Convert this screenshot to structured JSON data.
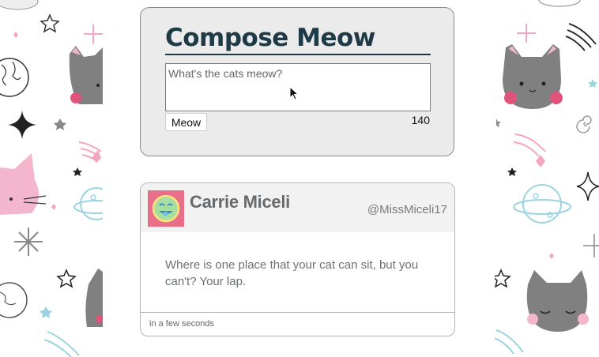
{
  "compose": {
    "title": "Compose Meow",
    "input_value": "",
    "placeholder": "What's the cats meow?",
    "button_label": "Meow",
    "char_count": "140"
  },
  "tweet": {
    "author_name": "Carrie Miceli",
    "handle": "@MissMiceli17",
    "text": "Where is one place that your cat can sit, but you can't? Your lap.",
    "timestamp": "in a few seconds"
  },
  "colors": {
    "title": "#1e3a47",
    "panel_bg": "#ebebeb",
    "avatar_bg": "#e76f8a",
    "avatar_face": "#a8dfa0",
    "cat_gray": "#808080",
    "cat_pink": "#f4b6cc",
    "planet_blue": "#9bd4e0"
  },
  "icons": [
    "cat-face-icon",
    "planet-icon",
    "sparkle-icon",
    "star-icon",
    "shooting-star-icon",
    "earth-icon",
    "mouse-cursor-icon",
    "smiley-avatar-icon"
  ]
}
